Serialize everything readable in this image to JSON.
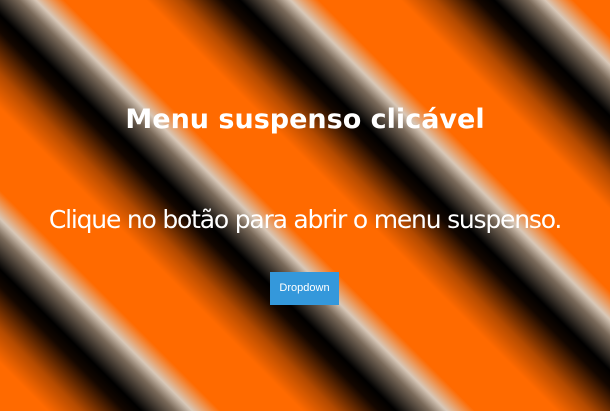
{
  "page": {
    "title": "Menu suspenso clicável",
    "subtitle": "Clique no botão para abrir o menu suspenso.",
    "background_colors": [
      "#ff6a00",
      "#000000",
      "#d8c8b8"
    ]
  },
  "dropdown": {
    "button_label": "Dropdown",
    "button_color": "#3498db",
    "text_color": "#ffffff"
  }
}
